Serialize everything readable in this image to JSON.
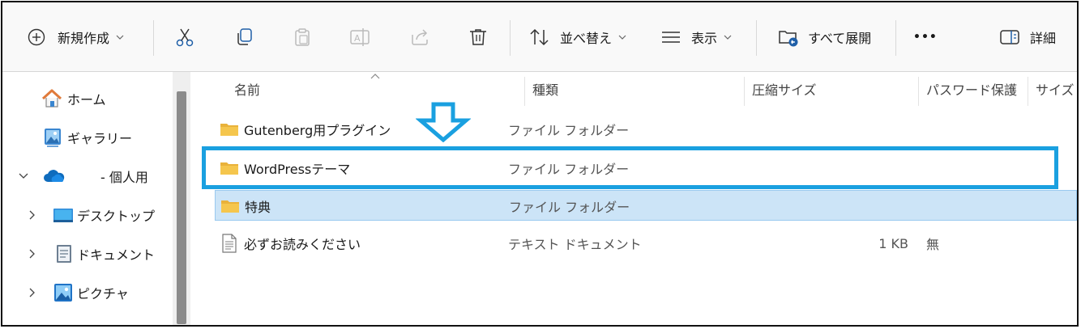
{
  "toolbar": {
    "new_label": "新規作成",
    "sort_label": "並べ替え",
    "view_label": "表示",
    "expand_all_label": "すべて展開",
    "more_label": "•••",
    "details_label": "詳細"
  },
  "sidebar": {
    "items": [
      {
        "label": "ホーム",
        "icon": "home-icon"
      },
      {
        "label": "ギャラリー",
        "icon": "gallery-icon"
      },
      {
        "label": "- 個人用",
        "icon": "onedrive-cloud-icon",
        "expanded": true
      },
      {
        "label": "デスクトップ",
        "icon": "desktop-icon"
      },
      {
        "label": "ドキュメント",
        "icon": "documents-icon"
      },
      {
        "label": "ピクチャ",
        "icon": "pictures-icon"
      }
    ]
  },
  "columns": {
    "name": "名前",
    "type": "種類",
    "compressed_size": "圧縮サイズ",
    "password": "パスワード保護",
    "size": "サイズ"
  },
  "files": [
    {
      "name": "Gutenberg用プラグイン",
      "type": "ファイル フォルダー",
      "size": "",
      "password": "",
      "icon": "folder-icon"
    },
    {
      "name": "WordPressテーマ",
      "type": "ファイル フォルダー",
      "size": "",
      "password": "",
      "icon": "folder-icon",
      "highlighted": true
    },
    {
      "name": "特典",
      "type": "ファイル フォルダー",
      "size": "",
      "password": "",
      "icon": "folder-icon",
      "selected": true
    },
    {
      "name": "必ずお読みください",
      "type": "テキスト ドキュメント",
      "size": "1 KB",
      "password": "無",
      "icon": "text-file-icon"
    }
  ],
  "colors": {
    "annotation": "#1aa0e0",
    "selection": "#cce4f7",
    "folder": "#f5c64d"
  }
}
